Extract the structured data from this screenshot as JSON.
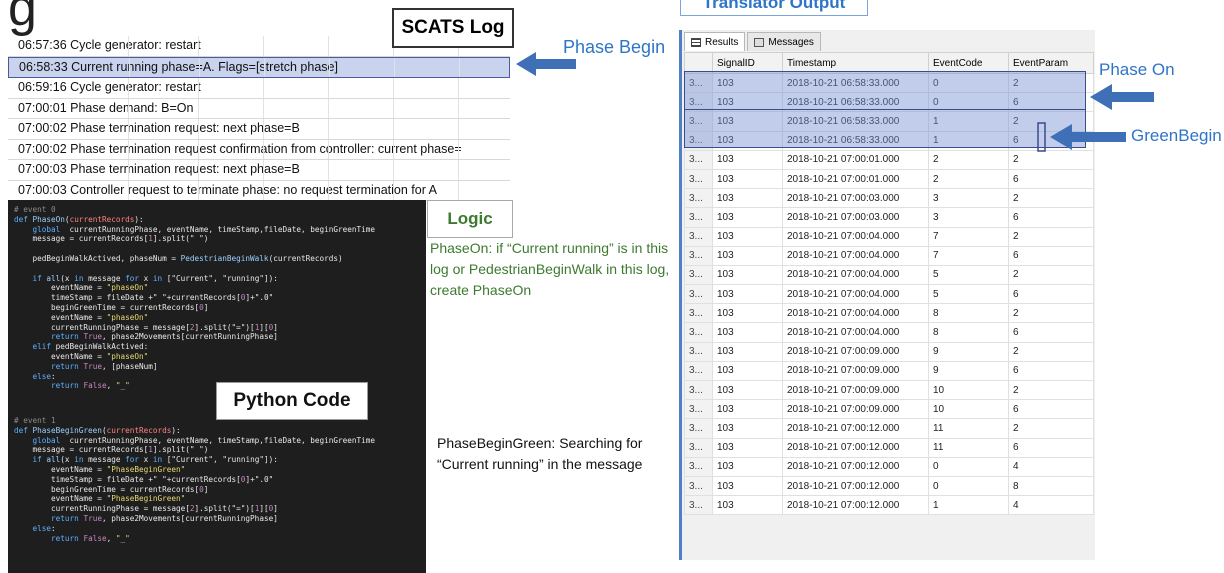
{
  "title_fragment": "g",
  "scats": {
    "label": "SCATS Log",
    "rows": [
      {
        "text": "06:57:36 Cycle generator: restart",
        "highlight": false
      },
      {
        "text": "06:58:33 Current running phase=A. Flags=[stretch phase]",
        "highlight": true
      },
      {
        "text": "06:59:16 Cycle generator: restart",
        "highlight": false
      },
      {
        "text": "07:00:01 Phase demand: B=On",
        "highlight": false
      },
      {
        "text": "07:00:02 Phase termination request: next phase=B",
        "highlight": false
      },
      {
        "text": "07:00:02 Phase termination request confirmation from controller: current phase=",
        "highlight": false
      },
      {
        "text": "07:00:03 Phase termination request: next phase=B",
        "highlight": false
      },
      {
        "text": "07:00:03 Controller request to terminate phase: no request termination for A",
        "highlight": false
      }
    ]
  },
  "annotations": {
    "phase_begin": "Phase Begin",
    "phase_on": "Phase On",
    "green_begin": "GreenBegin",
    "arrow_color": "#3f6fb6"
  },
  "logic": {
    "label": "Logic",
    "text": "PhaseOn:  if “Current running” is in this log or PedestrianBeginWalk  in this log, create PhaseOn",
    "color": "#3d7a2f"
  },
  "python": {
    "label": "Python Code",
    "phase_begin_green_text": "PhaseBeginGreen: Searching for “Current running” in the message"
  },
  "translator": {
    "label": "Translator Output",
    "tabs": [
      "Results",
      "Messages"
    ],
    "columns": [
      "",
      "SignalID",
      "Timestamp",
      "EventCode",
      "EventParam"
    ],
    "rows": [
      [
        "3...",
        "103",
        "2018-10-21 06:58:33.000",
        "0",
        "2"
      ],
      [
        "3...",
        "103",
        "2018-10-21 06:58:33.000",
        "0",
        "6"
      ],
      [
        "3...",
        "103",
        "2018-10-21 06:58:33.000",
        "1",
        "2"
      ],
      [
        "3...",
        "103",
        "2018-10-21 06:58:33.000",
        "1",
        "6"
      ],
      [
        "3...",
        "103",
        "2018-10-21 07:00:01.000",
        "2",
        "2"
      ],
      [
        "3...",
        "103",
        "2018-10-21 07:00:01.000",
        "2",
        "6"
      ],
      [
        "3...",
        "103",
        "2018-10-21 07:00:03.000",
        "3",
        "2"
      ],
      [
        "3...",
        "103",
        "2018-10-21 07:00:03.000",
        "3",
        "6"
      ],
      [
        "3...",
        "103",
        "2018-10-21 07:00:04.000",
        "7",
        "2"
      ],
      [
        "3...",
        "103",
        "2018-10-21 07:00:04.000",
        "7",
        "6"
      ],
      [
        "3...",
        "103",
        "2018-10-21 07:00:04.000",
        "5",
        "2"
      ],
      [
        "3...",
        "103",
        "2018-10-21 07:00:04.000",
        "5",
        "6"
      ],
      [
        "3...",
        "103",
        "2018-10-21 07:00:04.000",
        "8",
        "2"
      ],
      [
        "3...",
        "103",
        "2018-10-21 07:00:04.000",
        "8",
        "6"
      ],
      [
        "3...",
        "103",
        "2018-10-21 07:00:09.000",
        "9",
        "2"
      ],
      [
        "3...",
        "103",
        "2018-10-21 07:00:09.000",
        "9",
        "6"
      ],
      [
        "3...",
        "103",
        "2018-10-21 07:00:09.000",
        "10",
        "2"
      ],
      [
        "3...",
        "103",
        "2018-10-21 07:00:09.000",
        "10",
        "6"
      ],
      [
        "3...",
        "103",
        "2018-10-21 07:00:12.000",
        "11",
        "2"
      ],
      [
        "3...",
        "103",
        "2018-10-21 07:00:12.000",
        "11",
        "6"
      ],
      [
        "3...",
        "103",
        "2018-10-21 07:00:12.000",
        "0",
        "4"
      ],
      [
        "3...",
        "103",
        "2018-10-21 07:00:12.000",
        "0",
        "8"
      ],
      [
        "3...",
        "103",
        "2018-10-21 07:00:12.000",
        "1",
        "4"
      ]
    ]
  },
  "code": {
    "phase_on": [
      [
        [
          "c",
          "# event 0"
        ]
      ],
      [
        [
          "k",
          "def "
        ],
        [
          "f",
          "PhaseOn"
        ],
        [
          "t",
          "("
        ],
        [
          "v",
          "currentRecords"
        ],
        [
          "t",
          "):"
        ]
      ],
      [
        [
          "t",
          "    "
        ],
        [
          "k",
          "global "
        ],
        [
          "t",
          " currentRunningPhase, eventName, timeStamp,fileDate, beginGreenTime"
        ]
      ],
      [
        [
          "t",
          "    message = currentRecords["
        ],
        [
          "b",
          "1"
        ],
        [
          "t",
          "].split(\" \")"
        ]
      ],
      [
        [
          "t",
          ""
        ]
      ],
      [
        [
          "t",
          "    pedBeginWalkActived, phaseNum = "
        ],
        [
          "f",
          "PedestrianBeginWalk"
        ],
        [
          "t",
          "(currentRecords)"
        ]
      ],
      [
        [
          "t",
          ""
        ]
      ],
      [
        [
          "t",
          "    "
        ],
        [
          "k",
          "if "
        ],
        [
          "f",
          "all"
        ],
        [
          "t",
          "(x "
        ],
        [
          "k",
          "in "
        ],
        [
          "t",
          "message "
        ],
        [
          "k",
          "for "
        ],
        [
          "t",
          "x "
        ],
        [
          "k",
          "in "
        ],
        [
          "t",
          "[\"Current\", \"running\"]):"
        ]
      ],
      [
        [
          "t",
          "        eventName = "
        ],
        [
          "s",
          "\"phaseOn\""
        ]
      ],
      [
        [
          "t",
          "        timeStamp = fileDate +\" \"+currentRecords["
        ],
        [
          "b",
          "0"
        ],
        [
          "t",
          "]+\".0\""
        ]
      ],
      [
        [
          "t",
          "        beginGreenTime = currentRecords["
        ],
        [
          "b",
          "0"
        ],
        [
          "t",
          "]"
        ]
      ],
      [
        [
          "t",
          "        eventName = "
        ],
        [
          "s",
          "\"phaseOn\""
        ]
      ],
      [
        [
          "t",
          "        currentRunningPhase = message["
        ],
        [
          "b",
          "2"
        ],
        [
          "t",
          "].split(\"=\")["
        ],
        [
          "b",
          "1"
        ],
        [
          "t",
          "]["
        ],
        [
          "b",
          "0"
        ],
        [
          "t",
          "]"
        ]
      ],
      [
        [
          "t",
          "        "
        ],
        [
          "k",
          "return "
        ],
        [
          "b",
          "True"
        ],
        [
          "t",
          ", phase2Movements[currentRunningPhase]"
        ]
      ],
      [
        [
          "t",
          "    "
        ],
        [
          "k",
          "elif "
        ],
        [
          "t",
          "pedBeginWalkActived:"
        ]
      ],
      [
        [
          "t",
          "        eventName = "
        ],
        [
          "s",
          "\"phaseOn\""
        ]
      ],
      [
        [
          "t",
          "        "
        ],
        [
          "k",
          "return "
        ],
        [
          "b",
          "True"
        ],
        [
          "t",
          ", [phaseNum]"
        ]
      ],
      [
        [
          "t",
          "    "
        ],
        [
          "k",
          "else"
        ],
        [
          "t",
          ":"
        ]
      ],
      [
        [
          "t",
          "        "
        ],
        [
          "k",
          "return "
        ],
        [
          "b",
          "False"
        ],
        [
          "t",
          ", "
        ],
        [
          "s",
          "\"_\""
        ]
      ]
    ],
    "phase_begin_green": [
      [
        [
          "c",
          "# event 1"
        ]
      ],
      [
        [
          "k",
          "def "
        ],
        [
          "f",
          "PhaseBeginGreen"
        ],
        [
          "t",
          "("
        ],
        [
          "v",
          "currentRecords"
        ],
        [
          "t",
          "):"
        ]
      ],
      [
        [
          "t",
          "    "
        ],
        [
          "k",
          "global "
        ],
        [
          "t",
          " currentRunningPhase, eventName, timeStamp,fileDate, beginGreenTime"
        ]
      ],
      [
        [
          "t",
          "    message = currentRecords["
        ],
        [
          "b",
          "1"
        ],
        [
          "t",
          "].split(\" \")"
        ]
      ],
      [
        [
          "t",
          "    "
        ],
        [
          "k",
          "if "
        ],
        [
          "f",
          "all"
        ],
        [
          "t",
          "(x "
        ],
        [
          "k",
          "in "
        ],
        [
          "t",
          "message "
        ],
        [
          "k",
          "for "
        ],
        [
          "t",
          "x "
        ],
        [
          "k",
          "in "
        ],
        [
          "t",
          "[\"Current\", \"running\"]):"
        ]
      ],
      [
        [
          "t",
          "        eventName = "
        ],
        [
          "s",
          "\"PhaseBeginGreen\""
        ]
      ],
      [
        [
          "t",
          "        timeStamp = fileDate +\" \"+currentRecords["
        ],
        [
          "b",
          "0"
        ],
        [
          "t",
          "]+\".0\""
        ]
      ],
      [
        [
          "t",
          "        beginGreenTime = currentRecords["
        ],
        [
          "b",
          "0"
        ],
        [
          "t",
          "]"
        ]
      ],
      [
        [
          "t",
          "        eventName = "
        ],
        [
          "s",
          "\"PhaseBeginGreen\""
        ]
      ],
      [
        [
          "t",
          "        currentRunningPhase = message["
        ],
        [
          "b",
          "2"
        ],
        [
          "t",
          "].split(\"=\")["
        ],
        [
          "b",
          "1"
        ],
        [
          "t",
          "]["
        ],
        [
          "b",
          "0"
        ],
        [
          "t",
          "]"
        ]
      ],
      [
        [
          "t",
          "        "
        ],
        [
          "k",
          "return "
        ],
        [
          "b",
          "True"
        ],
        [
          "t",
          ", phase2Movements[currentRunningPhase]"
        ]
      ],
      [
        [
          "t",
          "    "
        ],
        [
          "k",
          "else"
        ],
        [
          "t",
          ":"
        ]
      ],
      [
        [
          "t",
          "        "
        ],
        [
          "k",
          "return "
        ],
        [
          "b",
          "False"
        ],
        [
          "t",
          ", "
        ],
        [
          "s",
          "\"_\""
        ]
      ]
    ]
  }
}
